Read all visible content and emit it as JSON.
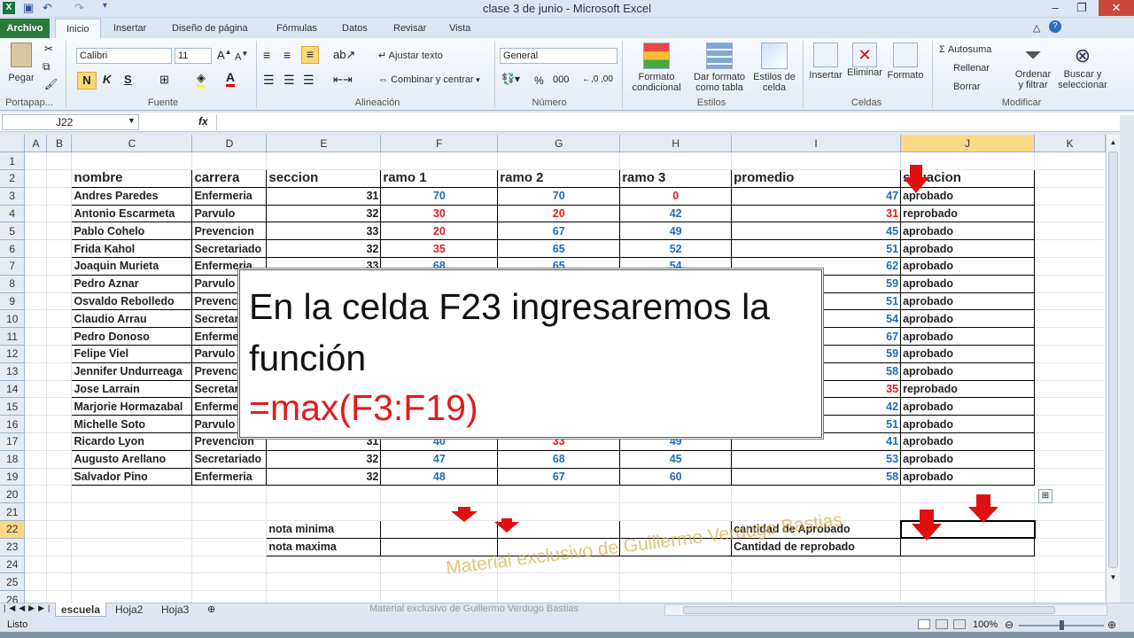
{
  "window": {
    "title": "clase 3 de junio  -  Microsoft Excel"
  },
  "menu": {
    "file": "Archivo",
    "tabs": [
      "Inicio",
      "Insertar",
      "Diseño de página",
      "Fórmulas",
      "Datos",
      "Revisar",
      "Vista"
    ]
  },
  "ribbon": {
    "paste": "Pegar",
    "font_name": "Calibri",
    "font_size": "11",
    "bold": "N",
    "italic": "K",
    "underline": "S",
    "wrap": "Ajustar texto",
    "merge": "Combinar y centrar",
    "number_format": "General",
    "cond_format": "Formato\ncondicional",
    "table_format": "Dar formato\ncomo tabla",
    "cell_styles": "Estilos de\ncelda",
    "insert": "Insertar",
    "delete": "Eliminar",
    "format": "Formato",
    "autosum": "Σ Autosuma",
    "fill": "Rellenar",
    "clear": "Borrar",
    "sort": "Ordenar\ny filtrar",
    "find": "Buscar y\nseleccionar",
    "groups": {
      "clipboard": "Portapap...",
      "font": "Fuente",
      "alignment": "Alineación",
      "number": "Número",
      "styles": "Estilos",
      "cells": "Celdas",
      "edit": "Modificar"
    }
  },
  "formula_bar": {
    "name_box": "J22",
    "fx": "fx",
    "formula": ""
  },
  "columns": [
    "",
    "A",
    "B",
    "C",
    "D",
    "E",
    "F",
    "G",
    "H",
    "I",
    "J",
    "K"
  ],
  "headers": {
    "nombre": "nombre",
    "carrera": "carrera",
    "seccion": "seccion",
    "ramo1": "ramo 1",
    "ramo2": "ramo 2",
    "ramo3": "ramo 3",
    "promedio": "promedio",
    "situacion": "situacion"
  },
  "rows": [
    {
      "nombre": "Andres Paredes",
      "carrera": "Enfermeria",
      "seccion": "31",
      "r1": "70",
      "r2": "70",
      "r3": "0",
      "prom": "47",
      "sit": "aprobado"
    },
    {
      "nombre": "Antonio Escarmeta",
      "carrera": "Parvulo",
      "seccion": "32",
      "r1": "30",
      "r2": "20",
      "r3": "42",
      "prom": "31",
      "sit": "reprobado"
    },
    {
      "nombre": "Pablo Cohelo",
      "carrera": "Prevencion",
      "seccion": "33",
      "r1": "20",
      "r2": "67",
      "r3": "49",
      "prom": "45",
      "sit": "aprobado"
    },
    {
      "nombre": "Frida Kahol",
      "carrera": "Secretariado",
      "seccion": "32",
      "r1": "35",
      "r2": "65",
      "r3": "52",
      "prom": "51",
      "sit": "aprobado"
    },
    {
      "nombre": "Joaquin Murieta",
      "carrera": "Enfermeria",
      "seccion": "33",
      "r1": "68",
      "r2": "65",
      "r3": "54",
      "prom": "62",
      "sit": "aprobado"
    },
    {
      "nombre": "Pedro Aznar",
      "carrera": "Parvulo",
      "seccion": "",
      "r1": "",
      "r2": "",
      "r3": "",
      "prom": "59",
      "sit": "aprobado"
    },
    {
      "nombre": "Osvaldo Rebolledo",
      "carrera": "Prevenc",
      "seccion": "",
      "r1": "",
      "r2": "",
      "r3": "",
      "prom": "51",
      "sit": "aprobado"
    },
    {
      "nombre": "Claudio Arrau",
      "carrera": "Secretar",
      "seccion": "",
      "r1": "",
      "r2": "",
      "r3": "",
      "prom": "54",
      "sit": "aprobado"
    },
    {
      "nombre": "Pedro Donoso",
      "carrera": "Enferme",
      "seccion": "",
      "r1": "",
      "r2": "",
      "r3": "",
      "prom": "67",
      "sit": "aprobado"
    },
    {
      "nombre": "Felipe Viel",
      "carrera": "Parvulo",
      "seccion": "",
      "r1": "",
      "r2": "",
      "r3": "",
      "prom": "59",
      "sit": "aprobado"
    },
    {
      "nombre": "Jennifer Undurreaga",
      "carrera": "Prevenc",
      "seccion": "",
      "r1": "",
      "r2": "",
      "r3": "",
      "prom": "58",
      "sit": "aprobado"
    },
    {
      "nombre": "Jose Larrain",
      "carrera": "Secretar",
      "seccion": "",
      "r1": "",
      "r2": "",
      "r3": "",
      "prom": "35",
      "sit": "reprobado"
    },
    {
      "nombre": "Marjorie Hormazabal",
      "carrera": "Enferme",
      "seccion": "",
      "r1": "",
      "r2": "",
      "r3": "",
      "prom": "42",
      "sit": "aprobado"
    },
    {
      "nombre": "Michelle Soto",
      "carrera": "Parvulo",
      "seccion": "",
      "r1": "",
      "r2": "",
      "r3": "",
      "prom": "51",
      "sit": "aprobado"
    },
    {
      "nombre": "Ricardo Lyon",
      "carrera": "Prevencion",
      "seccion": "31",
      "r1": "40",
      "r2": "33",
      "r3": "49",
      "prom": "41",
      "sit": "aprobado"
    },
    {
      "nombre": "Augusto Arellano",
      "carrera": "Secretariado",
      "seccion": "32",
      "r1": "47",
      "r2": "68",
      "r3": "45",
      "prom": "53",
      "sit": "aprobado"
    },
    {
      "nombre": "Salvador Pino",
      "carrera": "Enfermeria",
      "seccion": "32",
      "r1": "48",
      "r2": "67",
      "r3": "60",
      "prom": "58",
      "sit": "aprobado"
    }
  ],
  "summary": {
    "nota_minima": "nota minima",
    "nota_maxima": "nota maxima",
    "cant_aprobado": "cantidad de Aprobado",
    "cant_reprobado": "Cantidad de reprobado"
  },
  "callout": {
    "line1": "En la celda F23 ingresaremos la",
    "line2": "función",
    "line3": "=max(F3:F19)"
  },
  "sheets": [
    "escuela",
    "Hoja2",
    "Hoja3"
  ],
  "status": {
    "ready": "Listo",
    "zoom": "100%"
  },
  "watermark": "Material exclusivo de Guillermo Verdugo Bastias",
  "colors": {
    "pass": "#1f6cc0",
    "fail": "#e02020",
    "accent": "#2b7a3a",
    "arrow": "#e01010"
  }
}
